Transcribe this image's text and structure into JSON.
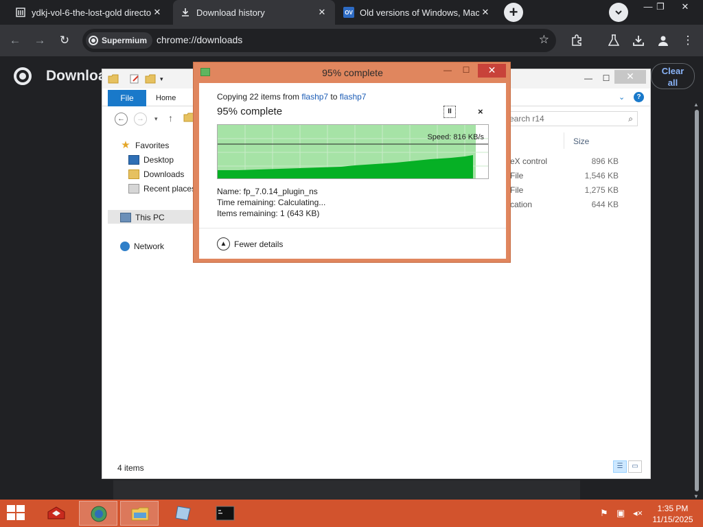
{
  "browser": {
    "tabs": [
      {
        "title": "ydkj-vol-6-the-lost-gold directo",
        "icon": "archive-icon",
        "active": false
      },
      {
        "title": "Download history",
        "icon": "download-icon",
        "active": true
      },
      {
        "title": "Old versions of Windows, Mac a",
        "icon": "ov-site-icon",
        "icon_text": "OV",
        "active": false
      }
    ],
    "chip_label": "Supermium",
    "url": "chrome://downloads"
  },
  "downloads_page": {
    "title": "Downloa",
    "clear_all_line1": "Clear",
    "clear_all_line2": "all"
  },
  "explorer": {
    "file_tab": "File",
    "home_tab": "Home",
    "search_placeholder": "earch r14",
    "nav_pane": {
      "favorites": "Favorites",
      "desktop": "Desktop",
      "downloads": "Downloads",
      "recent_places": "Recent places",
      "this_pc": "This PC",
      "network": "Network"
    },
    "size_column": "Size",
    "rows": [
      {
        "type": "eX control",
        "size": "896 KB"
      },
      {
        "type": "File",
        "size": "1,546 KB"
      },
      {
        "type": "File",
        "size": "1,275 KB"
      },
      {
        "type": "cation",
        "size": "644 KB"
      }
    ],
    "status": "4 items"
  },
  "copy_dialog": {
    "title": "95% complete",
    "copying_prefix": "Copying 22 items from ",
    "source": "flashp7",
    "to_word": " to ",
    "destination": "flashp7",
    "heading": "95% complete",
    "pause_label": "II",
    "close_label": "×",
    "speed": "Speed: 816 KB/s",
    "name_line": "Name:  fp_7.0.14_plugin_ns",
    "time_line": "Time remaining:  Calculating...",
    "items_line": "Items remaining:  1 (643 KB)",
    "fewer_details": "Fewer details",
    "progress_fraction": 0.95
  },
  "taskbar": {
    "time": "1:35 PM",
    "date": "11/15/2025"
  },
  "colors": {
    "chrome_bg": "#202124",
    "chrome_toolbar": "#35363a",
    "accent_link": "#8ab4f8",
    "dialog_frame": "#e0865e",
    "progress_green": "#06b025",
    "progress_light": "#a6e3a6",
    "taskbar": "#d2532d"
  }
}
